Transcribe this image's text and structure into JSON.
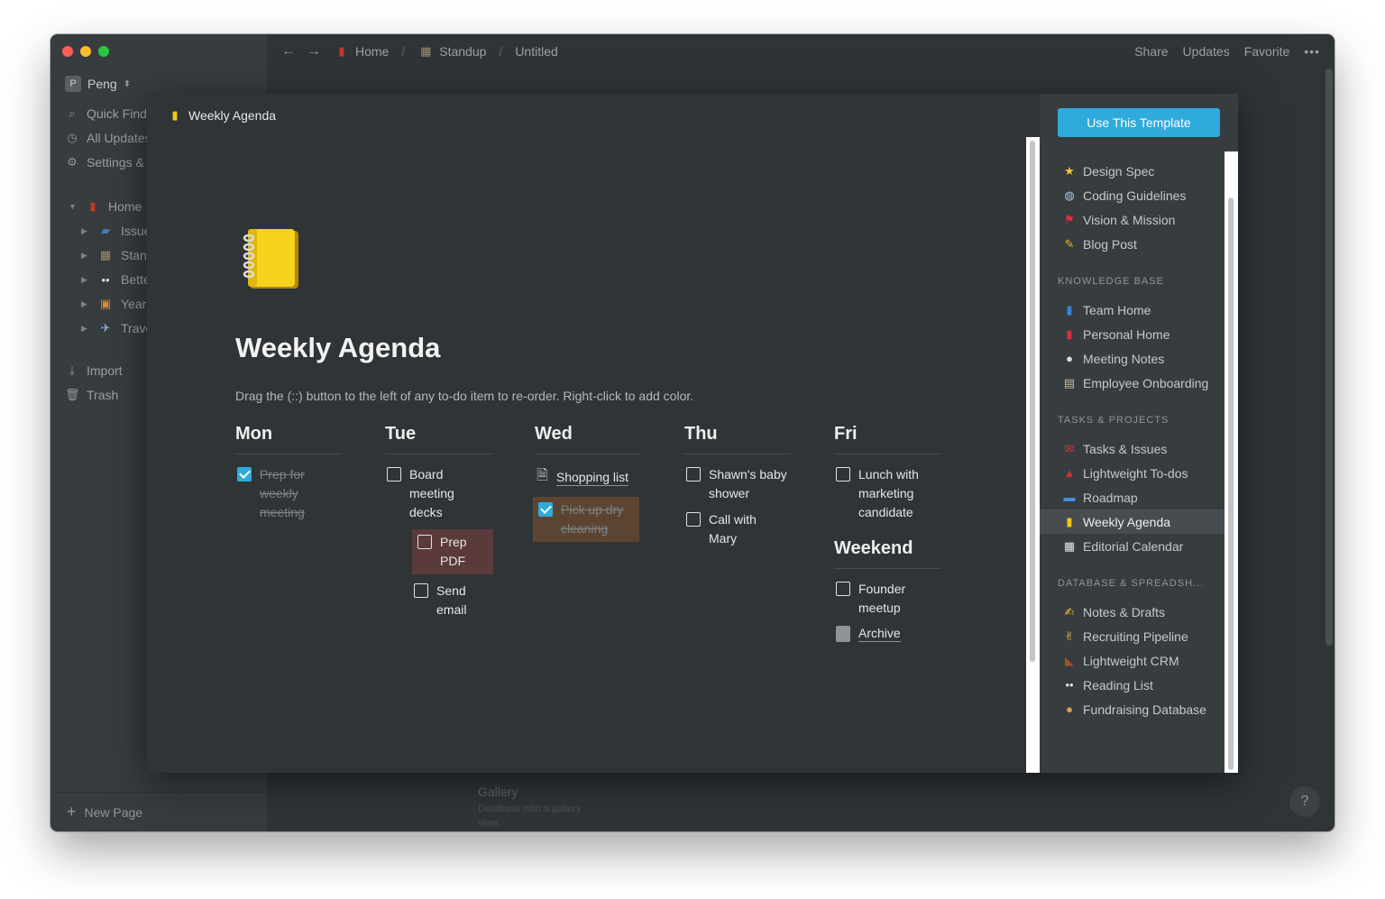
{
  "window": {
    "workspace": "Peng",
    "sidebar": {
      "quick_find": "Quick Find",
      "all_updates": "All Updates",
      "settings": "Settings &",
      "tree": [
        {
          "label": "Home",
          "icon": "red-book-icon"
        },
        {
          "label": "Issues",
          "icon": "seat-icon"
        },
        {
          "label": "Standup",
          "icon": "building-icon"
        },
        {
          "label": "Better",
          "icon": "eyes-icon"
        },
        {
          "label": "Year",
          "icon": "picture-icon"
        },
        {
          "label": "Travel",
          "icon": "airplane-icon"
        }
      ],
      "import": "Import",
      "trash": "Trash",
      "new_page": "New Page"
    },
    "topbar": {
      "breadcrumb": [
        "Home",
        "Standup",
        "Untitled"
      ],
      "share": "Share",
      "updates": "Updates",
      "favorite": "Favorite",
      "more": "•••"
    },
    "background": {
      "gallery_title": "Gallery",
      "gallery_sub": "Database with a gallery view."
    },
    "help": "?"
  },
  "preview": {
    "header_title": "Weekly Agenda",
    "title": "Weekly Agenda",
    "description": "Drag the (::) button to the left of any to-do item to re-order. Right-click to add color.",
    "days": {
      "mon": {
        "label": "Mon",
        "todo1": "Prep for weekly meeting"
      },
      "tue": {
        "label": "Tue",
        "todo1": "Board meeting decks",
        "todo2": "Prep PDF",
        "todo3": "Send email"
      },
      "wed": {
        "label": "Wed",
        "link1": "Shopping list",
        "todo1": "Pick up dry cleaning"
      },
      "thu": {
        "label": "Thu",
        "todo1": "Shawn's baby shower",
        "todo2": "Call with Mary"
      },
      "fri": {
        "label": "Fri",
        "todo1": "Lunch with marketing candidate"
      },
      "weekend": {
        "label": "Weekend",
        "todo1": "Founder meetup",
        "link1": "Archive"
      }
    }
  },
  "templates": {
    "use_button": "Use This Template",
    "group1": [
      {
        "label": "Design Spec",
        "icon": "star-icon"
      },
      {
        "label": "Coding Guidelines",
        "icon": "robot-icon"
      },
      {
        "label": "Vision & Mission",
        "icon": "flag-icon"
      },
      {
        "label": "Blog Post",
        "icon": "pencil-icon"
      }
    ],
    "knowledge_base": {
      "title": "KNOWLEDGE BASE",
      "items": [
        {
          "label": "Team Home",
          "icon": "blue-book-icon"
        },
        {
          "label": "Personal Home",
          "icon": "red-book-icon"
        },
        {
          "label": "Meeting Notes",
          "icon": "speech-bubble-icon"
        },
        {
          "label": "Employee Onboarding",
          "icon": "clipboard-icon"
        }
      ]
    },
    "tasks_projects": {
      "title": "TASKS & PROJECTS",
      "items": [
        {
          "label": "Tasks & Issues",
          "icon": "mailbox-icon"
        },
        {
          "label": "Lightweight To-dos",
          "icon": "backpack-icon"
        },
        {
          "label": "Roadmap",
          "icon": "bus-icon"
        },
        {
          "label": "Weekly Agenda",
          "icon": "notebook-icon"
        },
        {
          "label": "Editorial Calendar",
          "icon": "calendar-icon"
        }
      ]
    },
    "database": {
      "title": "DATABASE & SPREADSH...",
      "items": [
        {
          "label": "Notes & Drafts",
          "icon": "writing-hand-icon"
        },
        {
          "label": "Recruiting Pipeline",
          "icon": "victory-hand-icon"
        },
        {
          "label": "Lightweight CRM",
          "icon": "boot-icon"
        },
        {
          "label": "Reading List",
          "icon": "glasses-icon"
        },
        {
          "label": "Fundraising Database",
          "icon": "money-bag-icon"
        }
      ]
    }
  },
  "colors": {
    "accent": "#2eaadc",
    "background": "#2f3437",
    "sidebar": "#373c3f",
    "red_highlight": "#5a3a3a",
    "brown_highlight": "#5b4532"
  }
}
